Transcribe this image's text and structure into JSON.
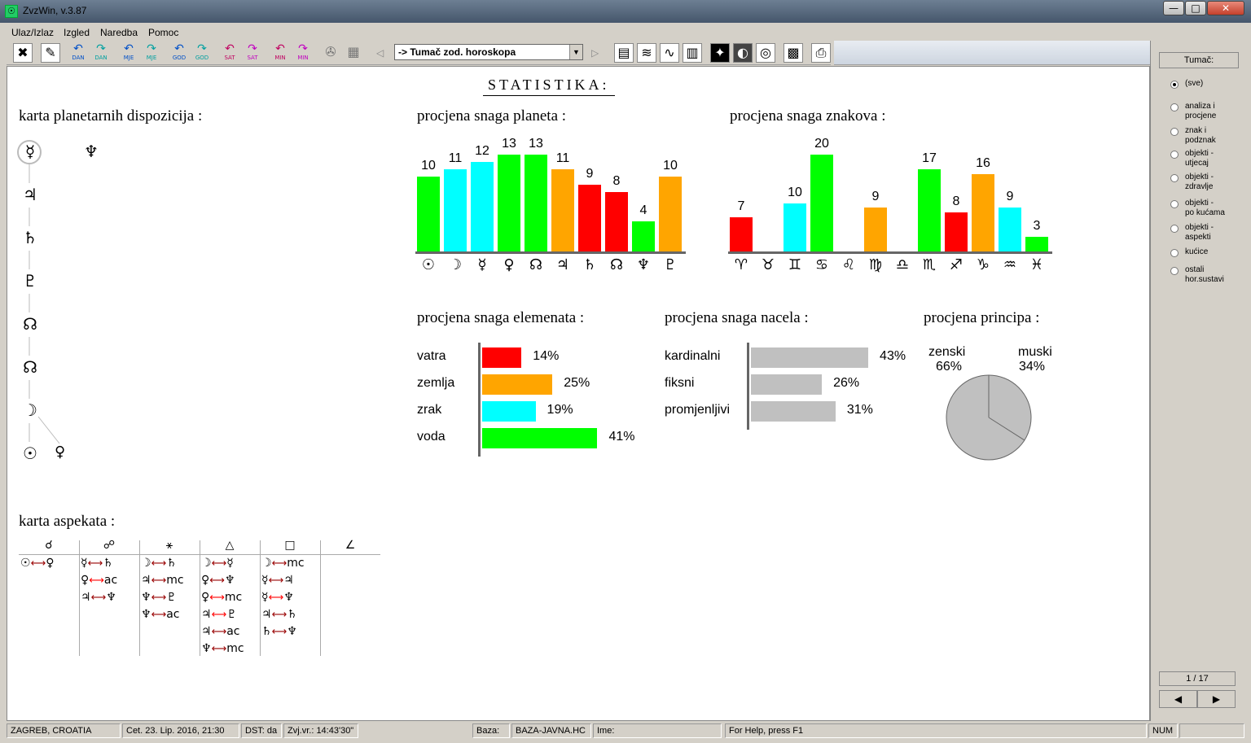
{
  "window": {
    "title": "ZvzWin,  v.3.87",
    "btn_min": "—",
    "btn_max": "□",
    "btn_close": "✕"
  },
  "menu": [
    "Ulaz/Izlaz",
    "Izgled",
    "Naredba",
    "Pomoc"
  ],
  "toolbar": {
    "buttons": [
      {
        "label": "DAN",
        "color": "#0050c8"
      },
      {
        "label": "DAN",
        "color": "#00a0a0"
      },
      {
        "label": "MJE",
        "color": "#0050c8"
      },
      {
        "label": "MJE",
        "color": "#00a0a0"
      },
      {
        "label": "GOD",
        "color": "#0050c8"
      },
      {
        "label": "GOD",
        "color": "#00a0a0"
      },
      {
        "label": "SAT",
        "color": "#c00060"
      },
      {
        "label": "SAT",
        "color": "#c000c0"
      },
      {
        "label": "MIN",
        "color": "#c00060"
      },
      {
        "label": "MIN",
        "color": "#c000c0"
      }
    ],
    "combo_value": "-> Tumač zod. horoskopa",
    "combo_dropdown": "▼",
    "nav_left": "◁",
    "nav_right": "▷"
  },
  "page_title": "STATISTIKA:",
  "dispozicije": {
    "title": "karta planetarnih dispozicija :",
    "column": [
      "☿",
      "♃",
      "♄",
      "♇",
      "☊",
      "☊",
      "☽",
      "☉"
    ],
    "neptune": "♆",
    "venus": "♀"
  },
  "snaga_planeta": {
    "title": "procjena snaga planeta :",
    "values": [
      10,
      11,
      12,
      13,
      13,
      11,
      9,
      8,
      4,
      10
    ],
    "colors": [
      "#00ff00",
      "#00ffff",
      "#00ffff",
      "#00ff00",
      "#00ff00",
      "#ffa500",
      "#ff0000",
      "#ff0000",
      "#00ff00",
      "#ffa500"
    ],
    "symbols": [
      "☉",
      "☽",
      "☿",
      "♀",
      "☊",
      "♃",
      "♄",
      "☊",
      "♆",
      "♇"
    ]
  },
  "snaga_znakova": {
    "title": "procjena snaga znakova :",
    "values": [
      7,
      0,
      10,
      20,
      0,
      9,
      0,
      17,
      8,
      16,
      9,
      3
    ],
    "colors": [
      "#ff0000",
      "#00ff00",
      "#00ffff",
      "#00ff00",
      "#ff0000",
      "#ffa500",
      "#00ffff",
      "#00ff00",
      "#ff0000",
      "#ffa500",
      "#00ffff",
      "#00ff00"
    ],
    "symbols": [
      "♈",
      "♉",
      "♊",
      "♋",
      "♌",
      "♍",
      "♎",
      "♏",
      "♐",
      "♑",
      "♒",
      "♓"
    ]
  },
  "elementi": {
    "title": "procjena snaga elemenata :",
    "items": [
      {
        "label": "vatra",
        "value": 14,
        "pct": "14%",
        "color": "#ff0000"
      },
      {
        "label": "zemlja",
        "value": 25,
        "pct": "25%",
        "color": "#ffa500"
      },
      {
        "label": "zrak",
        "value": 19,
        "pct": "19%",
        "color": "#00ffff"
      },
      {
        "label": "voda",
        "value": 41,
        "pct": "41%",
        "color": "#00ff00"
      }
    ]
  },
  "nacela": {
    "title": "procjena snaga nacela :",
    "items": [
      {
        "label": "kardinalni",
        "value": 43,
        "pct": "43%",
        "color": "#c0c0c0"
      },
      {
        "label": "fiksni",
        "value": 26,
        "pct": "26%",
        "color": "#c0c0c0"
      },
      {
        "label": "promjenljivi",
        "value": 31,
        "pct": "31%",
        "color": "#c0c0c0"
      }
    ]
  },
  "principi": {
    "title": "procjena principa :",
    "zenski_label": "zenski",
    "zenski_pct": "66%",
    "zenski_value": 66,
    "muski_label": "muski",
    "muski_pct": "34%",
    "muski_value": 34
  },
  "aspekti": {
    "title": "karta aspekata :",
    "headers": [
      "☌",
      "☍",
      "⚹",
      "△",
      "□",
      "∠"
    ],
    "columns": [
      [
        {
          "a": "☉",
          "b": "♀",
          "red": false
        }
      ],
      [
        {
          "a": "☿",
          "b": "♄",
          "red": false
        },
        {
          "a": "♀",
          "b": "ac",
          "red": true
        },
        {
          "a": "♃",
          "b": "♆",
          "red": false
        }
      ],
      [
        {
          "a": "☽",
          "b": "♄",
          "red": false
        },
        {
          "a": "♃",
          "b": "mc",
          "red": false
        },
        {
          "a": "♆",
          "b": "♇",
          "red": false
        },
        {
          "a": "♆",
          "b": "ac",
          "red": false
        }
      ],
      [
        {
          "a": "☽",
          "b": "☿",
          "red": false
        },
        {
          "a": "♀",
          "b": "♆",
          "red": false
        },
        {
          "a": "♀",
          "b": "mc",
          "red": true
        },
        {
          "a": "♃",
          "b": "♇",
          "red": true
        },
        {
          "a": "♃",
          "b": "ac",
          "red": false
        },
        {
          "a": "♆",
          "b": "mc",
          "red": false
        }
      ],
      [
        {
          "a": "☽",
          "b": "mc",
          "red": false
        },
        {
          "a": "☿",
          "b": "♃",
          "red": false
        },
        {
          "a": "☿",
          "b": "♆",
          "red": true
        },
        {
          "a": "♃",
          "b": "♄",
          "red": false
        },
        {
          "a": "♄",
          "b": "♆",
          "red": false
        }
      ],
      []
    ]
  },
  "right_panel": {
    "button": "Tumač:",
    "options": [
      "(sve)",
      "analiza i\nprocjene",
      "znak i\npodznak",
      "objekti -\nutjecaj",
      "objekti -\nzdravlje",
      "objekti -\npo kućama",
      "objekti -\naspekti",
      "kućice",
      "ostali\nhor.sustavi"
    ],
    "selected": 0,
    "page": "1 / 17",
    "prev": "◀",
    "next": "▶"
  },
  "status": {
    "place": "ZAGREB, CROATIA",
    "date": "Cet. 23. Lip. 2016, 21:30",
    "dst": "DST: da",
    "zvj": "Zvj.vr.: 14:43'30\"",
    "baza_label": "Baza:",
    "baza_value": "BAZA-JAVNA.HC",
    "ime": "Ime:",
    "help": "For Help, press F1",
    "num": "NUM"
  }
}
